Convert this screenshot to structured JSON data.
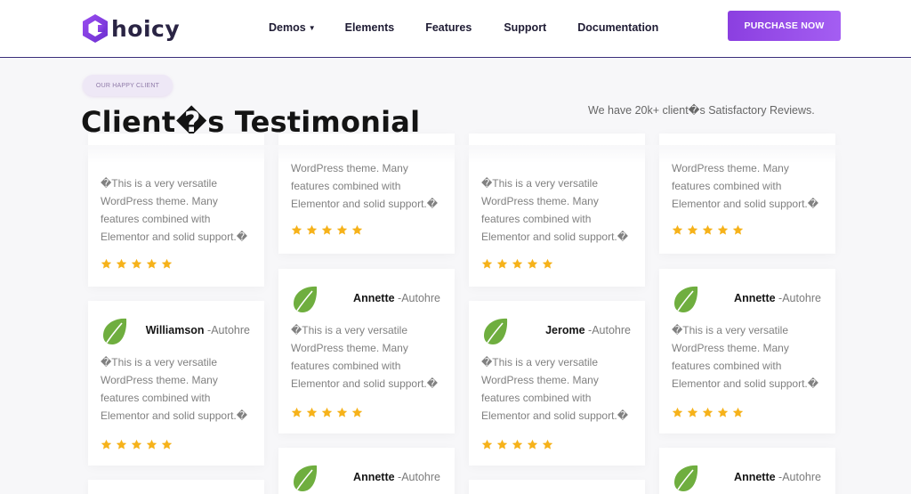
{
  "brand": {
    "logo_text": "hoicy",
    "accent": "#8b3fe0"
  },
  "nav": {
    "items": [
      "Demos",
      "Elements",
      "Features",
      "Support",
      "Documentation"
    ],
    "purchase_label": "PURCHASE NOW"
  },
  "section": {
    "badge": "OUR HAPPY CLIENT",
    "title": "Client�s Testimonial",
    "subtitle": "We have 20k+ client�s Satisfactory Reviews."
  },
  "testimonials": [
    {
      "name": "",
      "role": "",
      "lines": [
        "�This is a very versatile",
        "WordPress theme. Many",
        "features combined with",
        "Elementor and solid support.�"
      ],
      "rating": 5
    },
    {
      "name": "",
      "role": "",
      "lines": [
        "WordPress theme. Many",
        "features combined with",
        "Elementor and solid support.�"
      ],
      "rating": 5
    },
    {
      "name": "",
      "role": "",
      "lines": [
        "�This is a very versatile",
        "WordPress theme. Many",
        "features combined with",
        "Elementor and solid support.�"
      ],
      "rating": 5
    },
    {
      "name": "",
      "role": "",
      "lines": [
        "WordPress theme. Many",
        "features combined with",
        "Elementor and solid support.�"
      ],
      "rating": 5
    },
    {
      "name": "Annette",
      "role": " -Autohre",
      "lines": [
        "�This is a very versatile",
        "WordPress theme. Many",
        "features combined with",
        "Elementor and solid support.�"
      ],
      "rating": 5
    },
    {
      "name": "Annette",
      "role": " -Autohre",
      "lines": [
        "�This is a very versatile",
        "WordPress theme. Many",
        "features combined with",
        "Elementor and solid support.�"
      ],
      "rating": 5
    },
    {
      "name": "Williamson",
      "role": " -Autohre",
      "lines": [
        "�This is a very versatile",
        "WordPress theme. Many",
        "features combined with",
        "Elementor and solid support.�"
      ],
      "rating": 5
    },
    {
      "name": "Jerome",
      "role": " -Autohre",
      "lines": [
        "�This is a very versatile",
        "WordPress theme. Many",
        "features combined with",
        "Elementor and solid support.�"
      ],
      "rating": 5
    },
    {
      "name": "Annette",
      "role": " -Autohre",
      "lines": [],
      "rating": 0
    },
    {
      "name": "Annette",
      "role": " -Autohre",
      "lines": [],
      "rating": 0
    },
    {
      "name": "",
      "role": "",
      "lines": [],
      "rating": 0
    },
    {
      "name": "",
      "role": "",
      "lines": [],
      "rating": 0
    }
  ],
  "colors": {
    "leaf": "#6fae3f",
    "star": "#f6b21a",
    "title": "#141414",
    "header_rule": "#3b2f7a"
  }
}
